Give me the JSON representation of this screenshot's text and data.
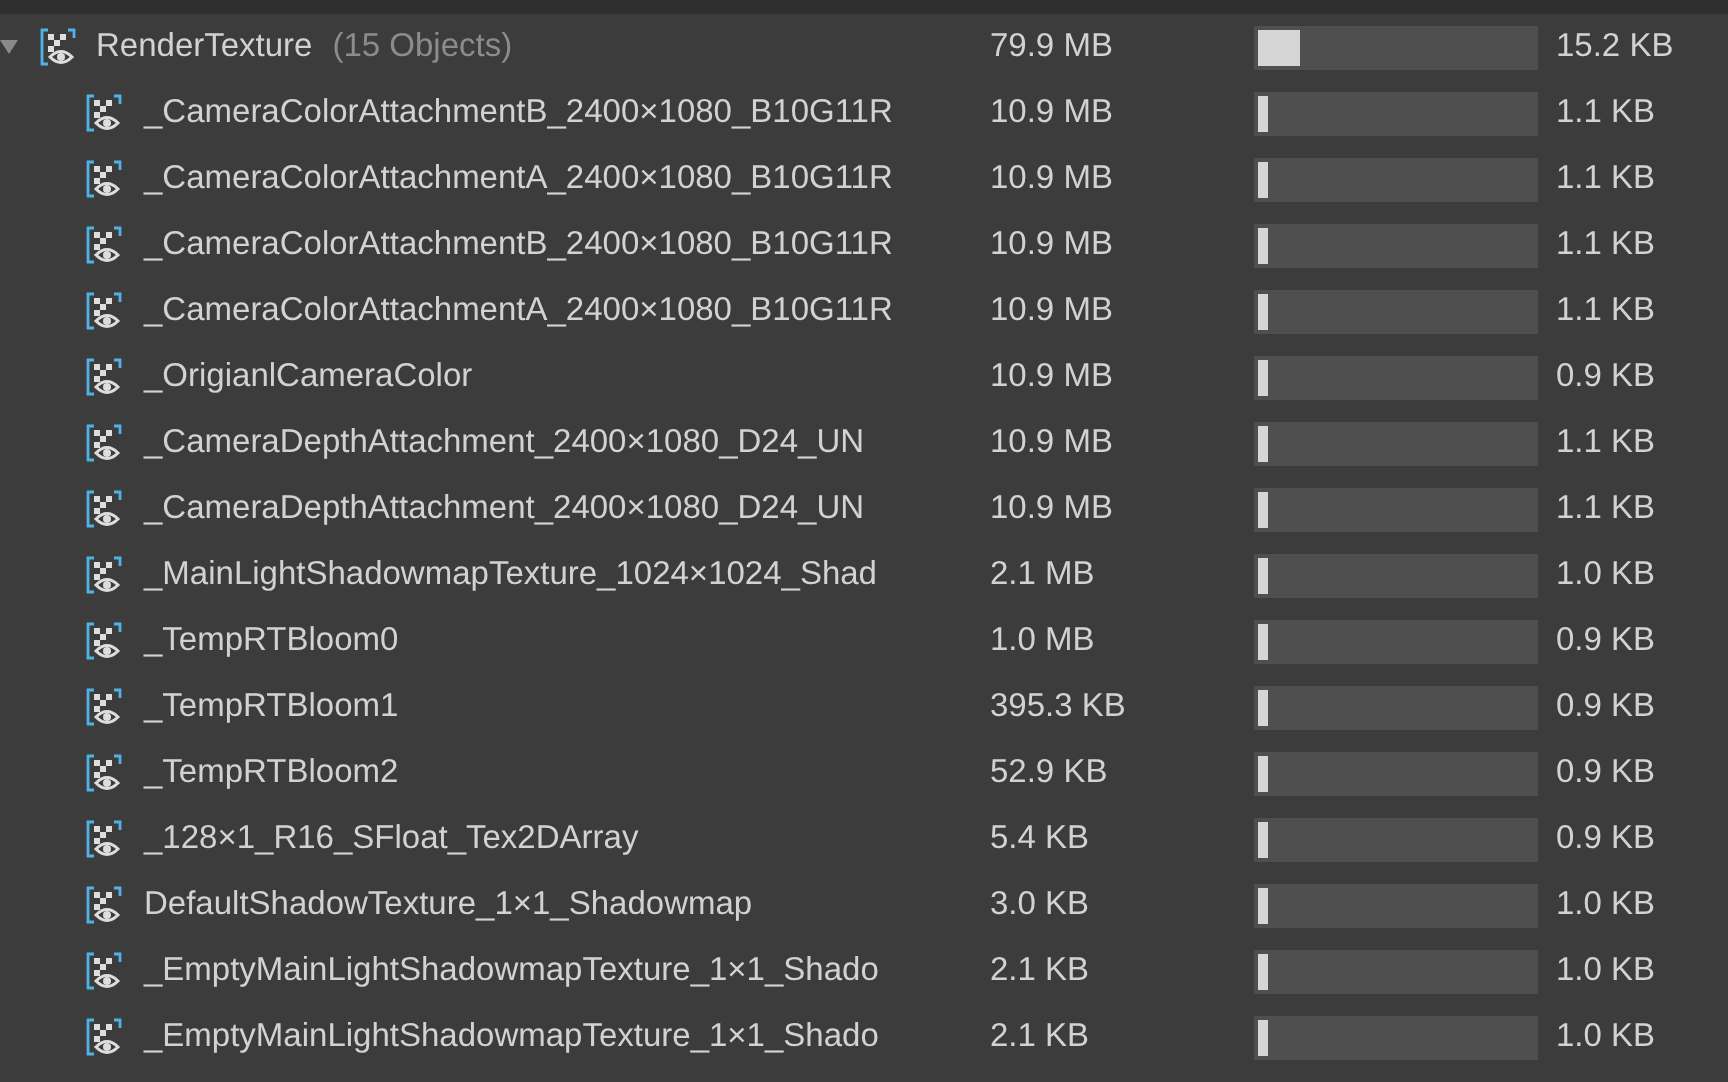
{
  "group": {
    "name": "RenderTexture",
    "count": "(15 Objects)",
    "size": "79.9 MB",
    "level": 0.15,
    "reading": "15.2 KB",
    "expanded": true,
    "children": [
      {
        "name": "_CameraColorAttachmentB_2400×1080_B10G11R",
        "size": "10.9 MB",
        "level": 0.035,
        "reading": "1.1 KB"
      },
      {
        "name": "_CameraColorAttachmentA_2400×1080_B10G11R",
        "size": "10.9 MB",
        "level": 0.035,
        "reading": "1.1 KB"
      },
      {
        "name": "_CameraColorAttachmentB_2400×1080_B10G11R",
        "size": "10.9 MB",
        "level": 0.035,
        "reading": "1.1 KB"
      },
      {
        "name": "_CameraColorAttachmentA_2400×1080_B10G11R",
        "size": "10.9 MB",
        "level": 0.035,
        "reading": "1.1 KB"
      },
      {
        "name": "_OrigianlCameraColor",
        "size": "10.9 MB",
        "level": 0.035,
        "reading": "0.9 KB"
      },
      {
        "name": "_CameraDepthAttachment_2400×1080_D24_UN",
        "size": "10.9 MB",
        "level": 0.035,
        "reading": "1.1 KB"
      },
      {
        "name": "_CameraDepthAttachment_2400×1080_D24_UN",
        "size": "10.9 MB",
        "level": 0.035,
        "reading": "1.1 KB"
      },
      {
        "name": "_MainLightShadowmapTexture_1024×1024_Shad",
        "size": "2.1 MB",
        "level": 0.035,
        "reading": "1.0 KB"
      },
      {
        "name": "_TempRTBloom0",
        "size": "1.0 MB",
        "level": 0.035,
        "reading": "0.9 KB"
      },
      {
        "name": "_TempRTBloom1",
        "size": "395.3 KB",
        "level": 0.035,
        "reading": "0.9 KB"
      },
      {
        "name": "_TempRTBloom2",
        "size": "52.9 KB",
        "level": 0.035,
        "reading": "0.9 KB"
      },
      {
        "name": "_128×1_R16_SFloat_Tex2DArray",
        "size": "5.4 KB",
        "level": 0.035,
        "reading": "0.9 KB"
      },
      {
        "name": "DefaultShadowTexture_1×1_Shadowmap",
        "size": "3.0 KB",
        "level": 0.035,
        "reading": "1.0 KB"
      },
      {
        "name": "_EmptyMainLightShadowmapTexture_1×1_Shado",
        "size": "2.1 KB",
        "level": 0.035,
        "reading": "1.0 KB"
      },
      {
        "name": "_EmptyMainLightShadowmapTexture_1×1_Shado",
        "size": "2.1 KB",
        "level": 0.035,
        "reading": "1.0 KB"
      }
    ]
  }
}
